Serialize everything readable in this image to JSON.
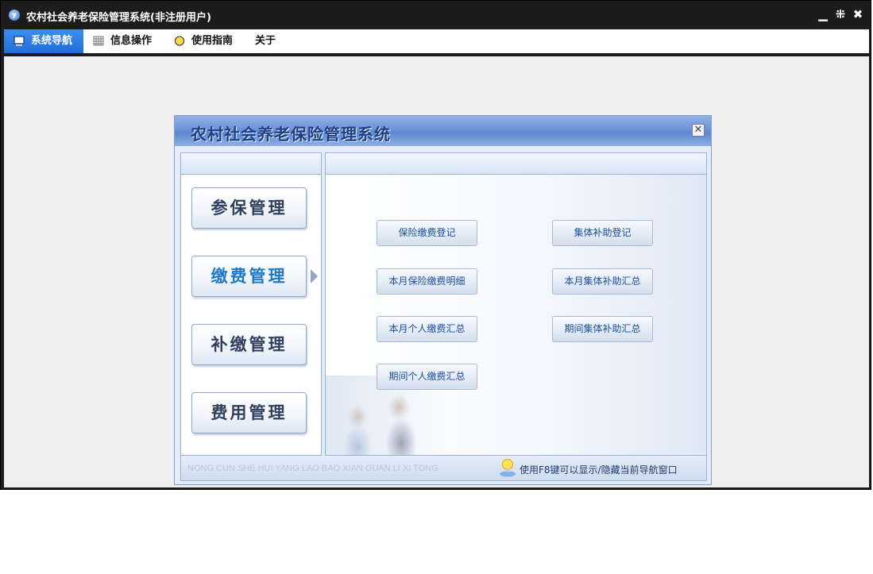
{
  "window": {
    "title": "农村社会养老保险管理系统(非注册用户)",
    "icon_letter": "y",
    "controls": [
      "minimize",
      "restore",
      "close"
    ]
  },
  "menubar": {
    "tabs": [
      {
        "label": "系统导航",
        "icon": "monitor-icon",
        "active": true
      },
      {
        "label": "信息操作",
        "icon": "grid-icon",
        "active": false
      },
      {
        "label": "使用指南",
        "icon": "help-circle-icon",
        "active": false
      },
      {
        "label": "关于",
        "icon": "",
        "active": false
      }
    ]
  },
  "nav": {
    "title": "农村社会养老保险管理系统",
    "categories": [
      {
        "label": "参保管理",
        "active": false
      },
      {
        "label": "缴费管理",
        "active": true
      },
      {
        "label": "补缴管理",
        "active": false
      },
      {
        "label": "费用管理",
        "active": false
      }
    ],
    "functions": [
      "保险缴费登记",
      "集体补助登记",
      "本月保险缴费明细",
      "本月集体补助汇总",
      "本月个人缴费汇总",
      "期间集体补助汇总",
      "期间个人缴费汇总"
    ],
    "footer_pinyin": "NONG CUN SHE HUI YANG LAO BAO XIAN GUAN LI XI TONG",
    "footer_hint": "使用F8键可以显示/隐藏当前导航窗口"
  },
  "colors": {
    "active_tab": "#2a7de1",
    "nav_header": "#6c94d8",
    "function_text": "#1b4ea0"
  }
}
